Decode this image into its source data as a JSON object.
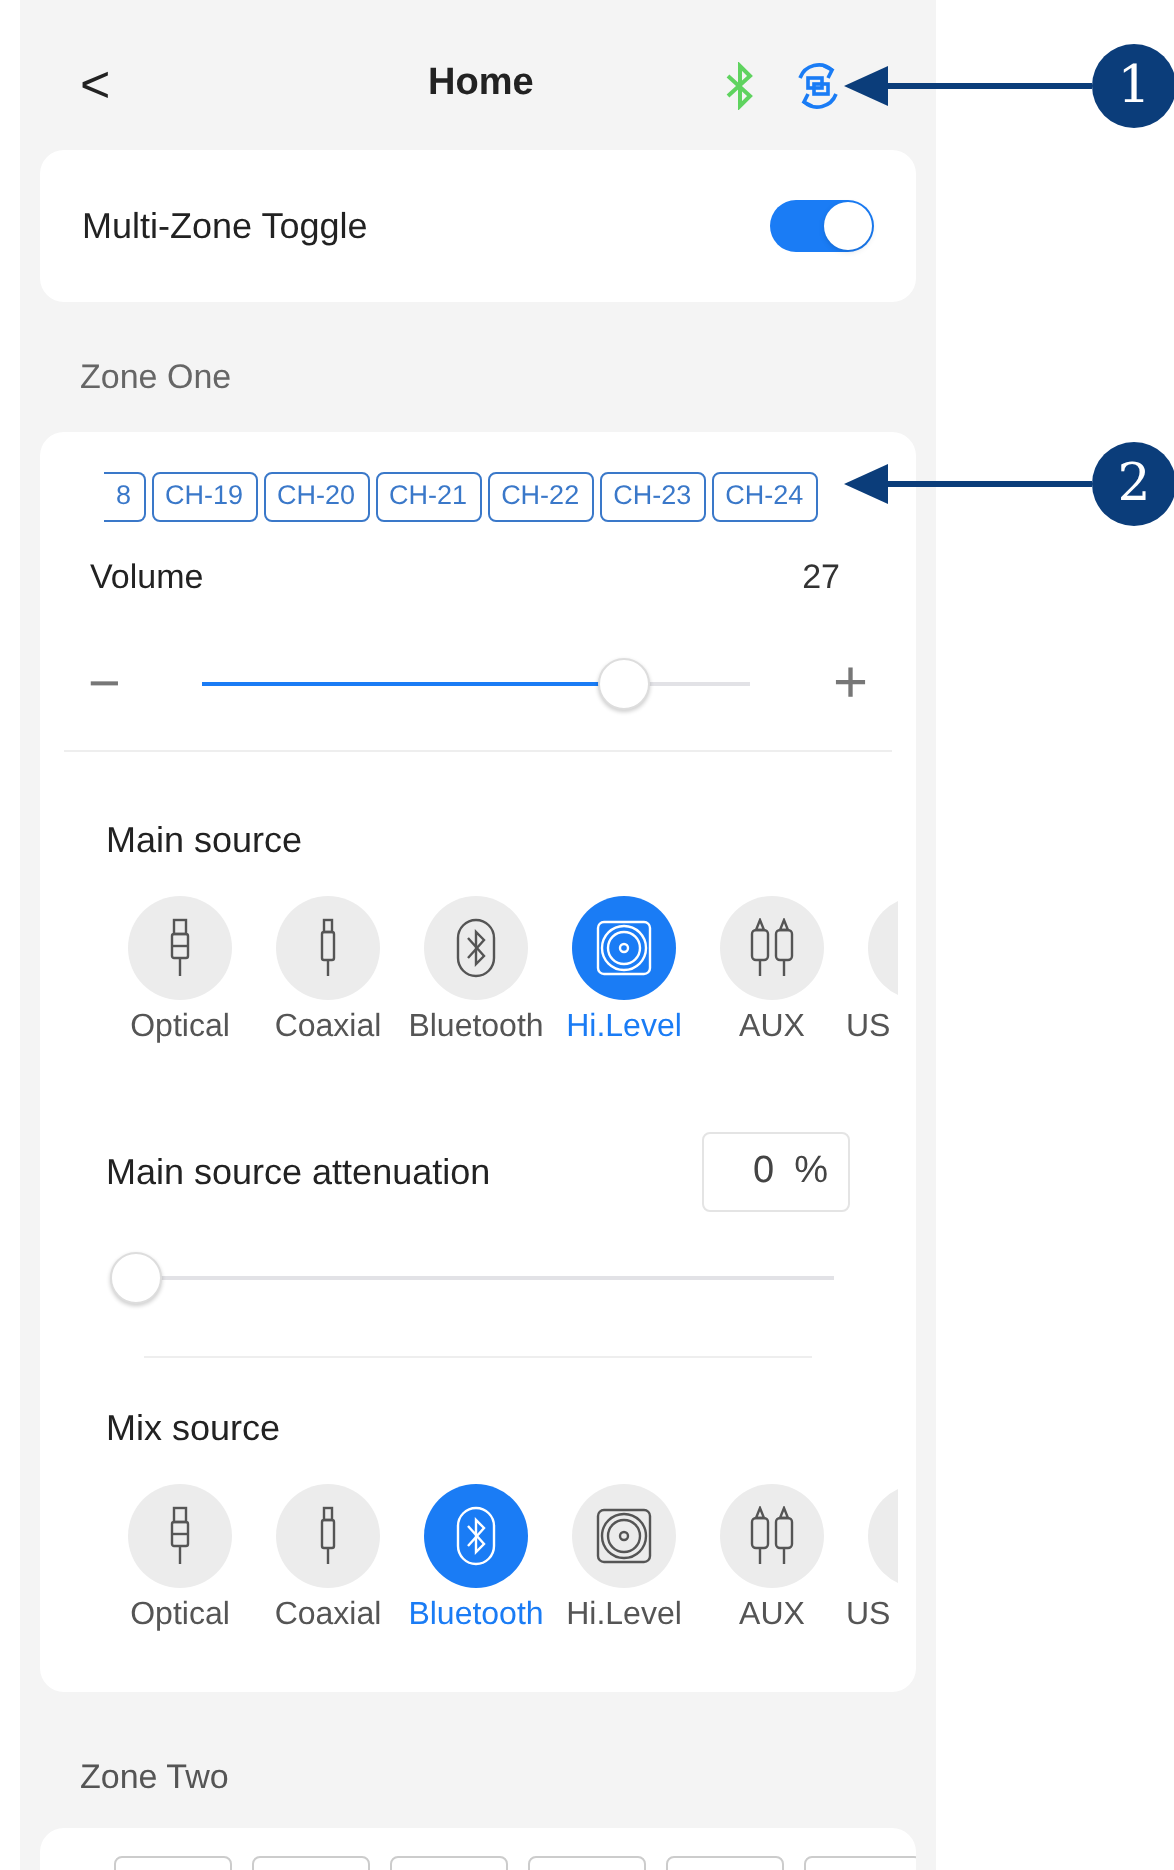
{
  "header": {
    "back": "<",
    "title": "Home"
  },
  "multi_zone": {
    "label": "Multi-Zone Toggle",
    "on": true
  },
  "zone_one": {
    "title": "Zone One",
    "channels": [
      {
        "label": "8",
        "selected": false
      },
      {
        "label": "CH-19",
        "selected": false
      },
      {
        "label": "CH-20",
        "selected": false
      },
      {
        "label": "CH-21",
        "selected": false
      },
      {
        "label": "CH-22",
        "selected": false
      },
      {
        "label": "CH-23",
        "selected": false
      },
      {
        "label": "CH-24",
        "selected": false
      }
    ],
    "volume": {
      "label": "Volume",
      "value": "27",
      "level": 0.77,
      "minus": "−",
      "plus": "+"
    },
    "main_source": {
      "title": "Main source",
      "items": [
        {
          "label": "Optical",
          "kind": "optical",
          "selected": false
        },
        {
          "label": "Coaxial",
          "kind": "coaxial",
          "selected": false
        },
        {
          "label": "Bluetooth",
          "kind": "bluetooth",
          "selected": false
        },
        {
          "label": "Hi.Level",
          "kind": "speaker",
          "selected": true
        },
        {
          "label": "AUX",
          "kind": "rca",
          "selected": false
        },
        {
          "label": "US",
          "kind": "usb",
          "selected": false
        }
      ]
    },
    "attenuation": {
      "label": "Main source attenuation",
      "value": "0",
      "unit": "%",
      "level": 0
    },
    "mix_source": {
      "title": "Mix source",
      "items": [
        {
          "label": "Optical",
          "kind": "optical",
          "selected": false
        },
        {
          "label": "Coaxial",
          "kind": "coaxial",
          "selected": false
        },
        {
          "label": "Bluetooth",
          "kind": "bluetooth",
          "selected": true
        },
        {
          "label": "Hi.Level",
          "kind": "speaker",
          "selected": false
        },
        {
          "label": "AUX",
          "kind": "rca",
          "selected": false
        },
        {
          "label": "US",
          "kind": "usb",
          "selected": false
        }
      ]
    }
  },
  "zone_two": {
    "title": "Zone Two"
  },
  "callouts": [
    {
      "label": "1"
    },
    {
      "label": "2"
    }
  ]
}
